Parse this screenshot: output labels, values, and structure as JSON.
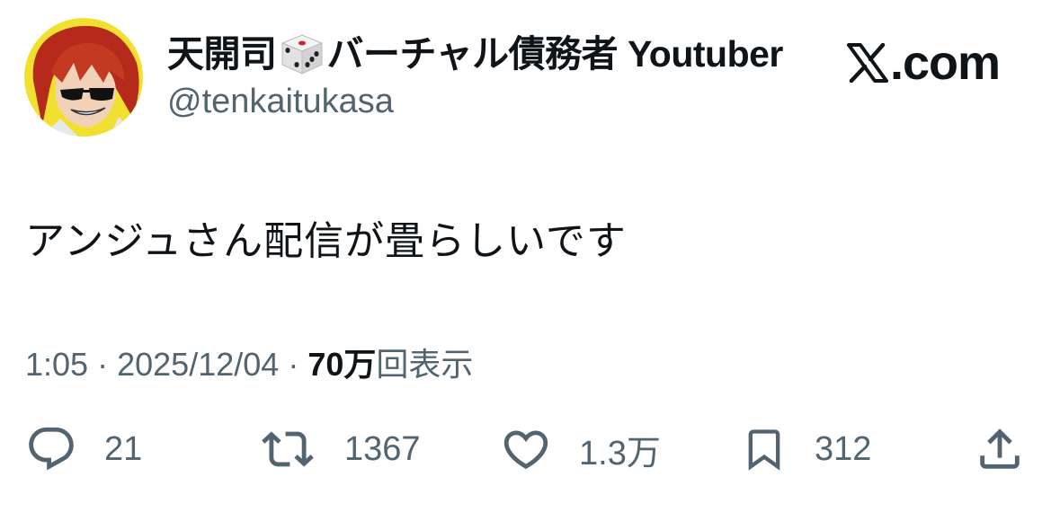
{
  "author": {
    "name_prefix": "天開司",
    "name_suffix": "バーチャル債務者 Youtuber",
    "handle": "@tenkaitukasa"
  },
  "brand": {
    "label": ".com"
  },
  "tweet": {
    "text": "アンジュさん配信が畳らしいです",
    "time": "1:05",
    "separator": "·",
    "date": "2025/12/04",
    "views_count": "70万",
    "views_label": "回表示"
  },
  "actions": {
    "replies": "21",
    "retweets": "1367",
    "likes": "1.3万",
    "bookmarks": "312"
  },
  "colors": {
    "text": "#0f1419",
    "secondary": "#536471",
    "avatar_bg": "#f2e030",
    "hair": "#b52a1a"
  },
  "icons": {
    "reply": "reply-icon",
    "retweet": "retweet-icon",
    "like": "heart-icon",
    "bookmark": "bookmark-icon",
    "share": "share-icon",
    "dice": "dice-emoji-icon",
    "x_logo": "x-logo-icon"
  }
}
